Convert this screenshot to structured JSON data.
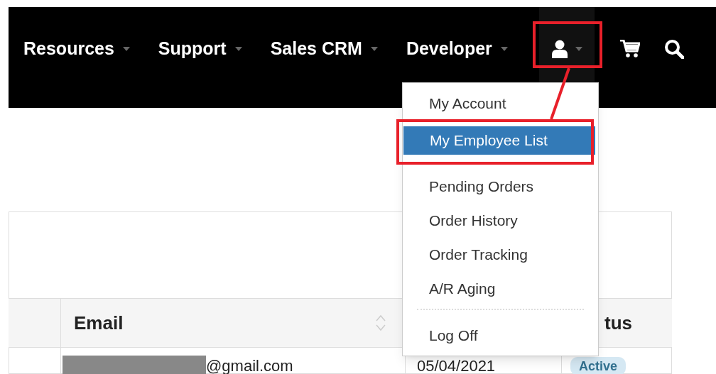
{
  "nav": {
    "items": [
      {
        "label": "Resources"
      },
      {
        "label": "Support"
      },
      {
        "label": "Sales CRM"
      },
      {
        "label": "Developer"
      }
    ],
    "account_menu_open": true
  },
  "account_menu": {
    "items": [
      {
        "kind": "item",
        "label": "My Account",
        "selected": false
      },
      {
        "kind": "item",
        "label": "My Employee List",
        "selected": true
      },
      {
        "kind": "item",
        "label": "Pending Orders",
        "selected": false
      },
      {
        "kind": "item",
        "label": "Order History",
        "selected": false
      },
      {
        "kind": "item",
        "label": "Order Tracking",
        "selected": false
      },
      {
        "kind": "item",
        "label": "A/R Aging",
        "selected": false
      },
      {
        "kind": "divider"
      },
      {
        "kind": "item",
        "label": "Log Off",
        "selected": false
      }
    ]
  },
  "table": {
    "columns": [
      {
        "label": "Email",
        "sortable": true
      },
      {
        "label": "tus"
      }
    ],
    "rows": [
      {
        "email": "@gmail.com",
        "date": "05/04/2021",
        "status": "Active"
      }
    ]
  }
}
